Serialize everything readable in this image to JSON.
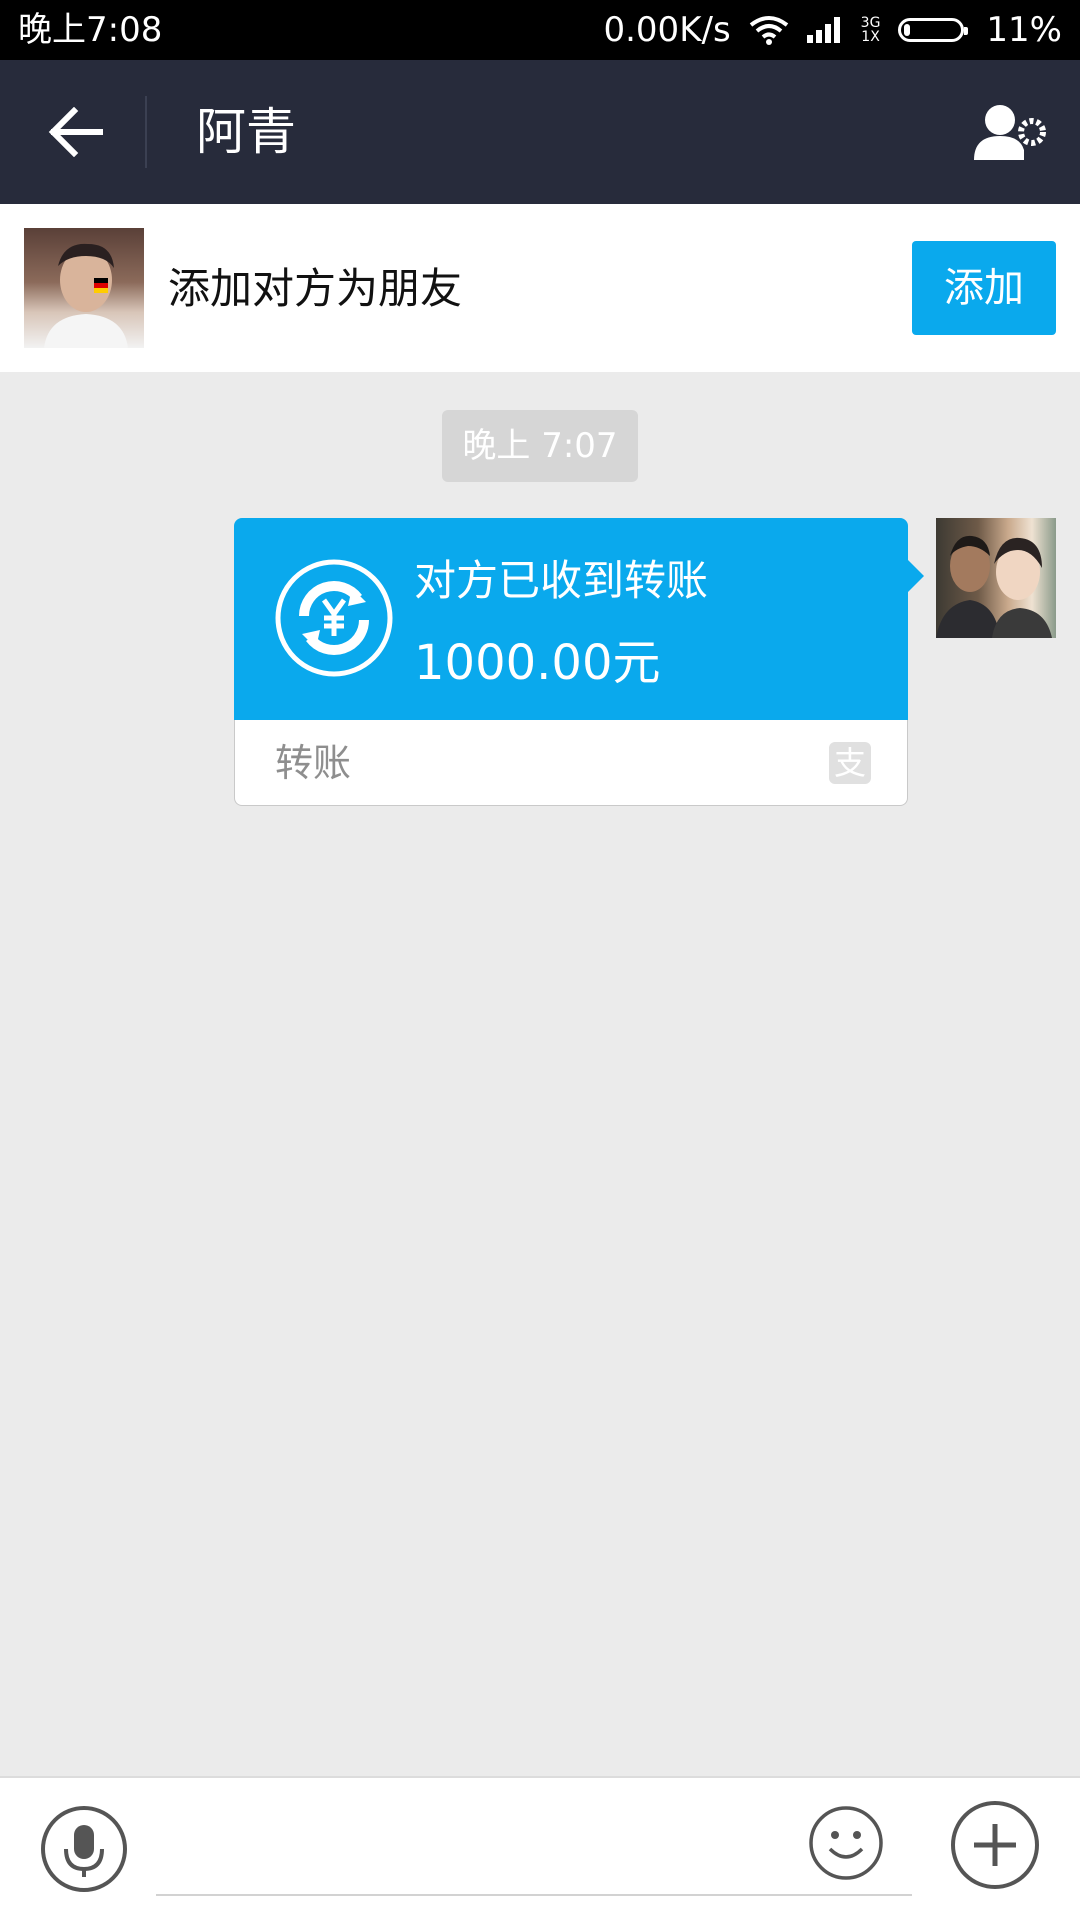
{
  "status_bar": {
    "time": "晚上7:08",
    "speed": "0.00K/s",
    "network_top": "3G",
    "network_bottom": "1X",
    "battery_pct": "11%",
    "icons": [
      "wifi-icon",
      "signal-icon",
      "battery-icon"
    ]
  },
  "header": {
    "title": "阿青",
    "icons": [
      "back-arrow-icon",
      "profile-settings-icon"
    ]
  },
  "add_friend": {
    "text": "添加对方为朋友",
    "button_label": "添加"
  },
  "chat": {
    "timestamp": "晚上 7:07",
    "transfer": {
      "status": "对方已收到转账",
      "amount": "1000.00元",
      "type_label": "转账",
      "alipay_glyph": "支"
    }
  },
  "input_bar": {
    "placeholder": "",
    "icons": [
      "microphone-icon",
      "smiley-icon",
      "plus-icon"
    ]
  },
  "colors": {
    "status_bar_bg": "#000000",
    "header_bg": "#272b3b",
    "accent_blue": "#0aa9ed",
    "chat_bg": "#ebebeb",
    "timestamp_bg": "#d6d6d6"
  }
}
